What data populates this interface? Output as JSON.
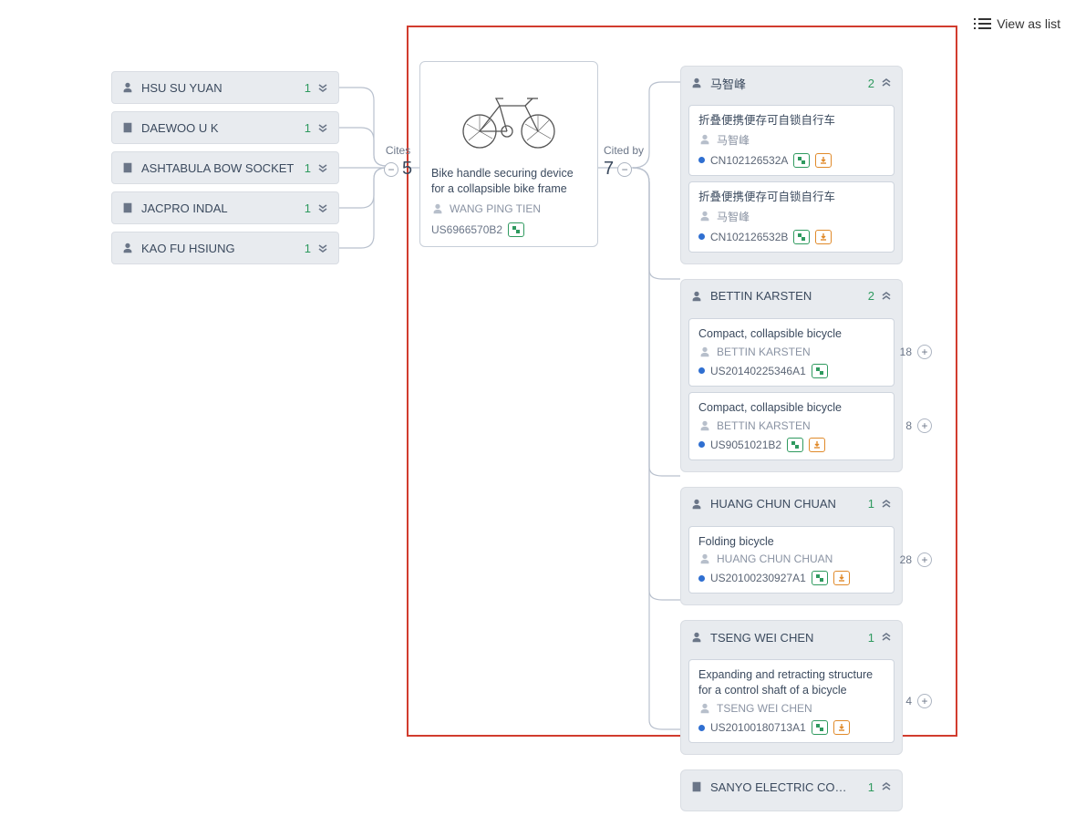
{
  "toolbar": {
    "view_as_list": "View as list"
  },
  "cites": {
    "label": "Cites",
    "count": "5",
    "groups": [
      {
        "name": "HSU SU YUAN",
        "icon": "person",
        "count": 1
      },
      {
        "name": "DAEWOO U K",
        "icon": "building",
        "count": 1
      },
      {
        "name": "ASHTABULA BOW SOCKET",
        "icon": "building",
        "count": 1
      },
      {
        "name": "JACPRO INDAL",
        "icon": "building",
        "count": 1
      },
      {
        "name": "KAO FU HSIUNG",
        "icon": "person",
        "count": 1
      }
    ]
  },
  "focus": {
    "title": "Bike handle securing device for a collapsible bike frame",
    "inventor": "WANG PING TIEN",
    "pub_number": "US6966570B2"
  },
  "cited_by": {
    "label": "Cited by",
    "count": "7",
    "groups": [
      {
        "name": "马智峰",
        "icon": "person",
        "count": 2,
        "patents": [
          {
            "title": "折叠便携便存可自锁自行车",
            "inventor": "马智峰",
            "pub_number": "CN102126532A",
            "badges": [
              "green",
              "orange"
            ]
          },
          {
            "title": "折叠便携便存可自锁自行车",
            "inventor": "马智峰",
            "pub_number": "CN102126532B",
            "badges": [
              "green",
              "orange"
            ]
          }
        ]
      },
      {
        "name": "BETTIN KARSTEN",
        "icon": "person",
        "count": 2,
        "patents": [
          {
            "title": "Compact, collapsible bicycle",
            "inventor": "BETTIN KARSTEN",
            "pub_number": "US20140225346A1",
            "badges": [
              "green"
            ],
            "forward_citations": 18
          },
          {
            "title": "Compact, collapsible bicycle",
            "inventor": "BETTIN KARSTEN",
            "pub_number": "US9051021B2",
            "badges": [
              "green",
              "orange"
            ],
            "forward_citations": 8
          }
        ]
      },
      {
        "name": "HUANG CHUN CHUAN",
        "icon": "person",
        "count": 1,
        "patents": [
          {
            "title": "Folding bicycle",
            "inventor": "HUANG CHUN CHUAN",
            "pub_number": "US20100230927A1",
            "badges": [
              "green",
              "orange"
            ],
            "forward_citations": 28
          }
        ]
      },
      {
        "name": "TSENG WEI CHEN",
        "icon": "person",
        "count": 1,
        "patents": [
          {
            "title": "Expanding and retracting structure for a control shaft of a bicycle",
            "inventor": "TSENG WEI CHEN",
            "pub_number": "US20100180713A1",
            "badges": [
              "green",
              "orange"
            ],
            "forward_citations": 4
          }
        ]
      },
      {
        "name": "SANYO ELECTRIC CO LTD",
        "icon": "building",
        "count": 1,
        "patents": []
      }
    ]
  }
}
